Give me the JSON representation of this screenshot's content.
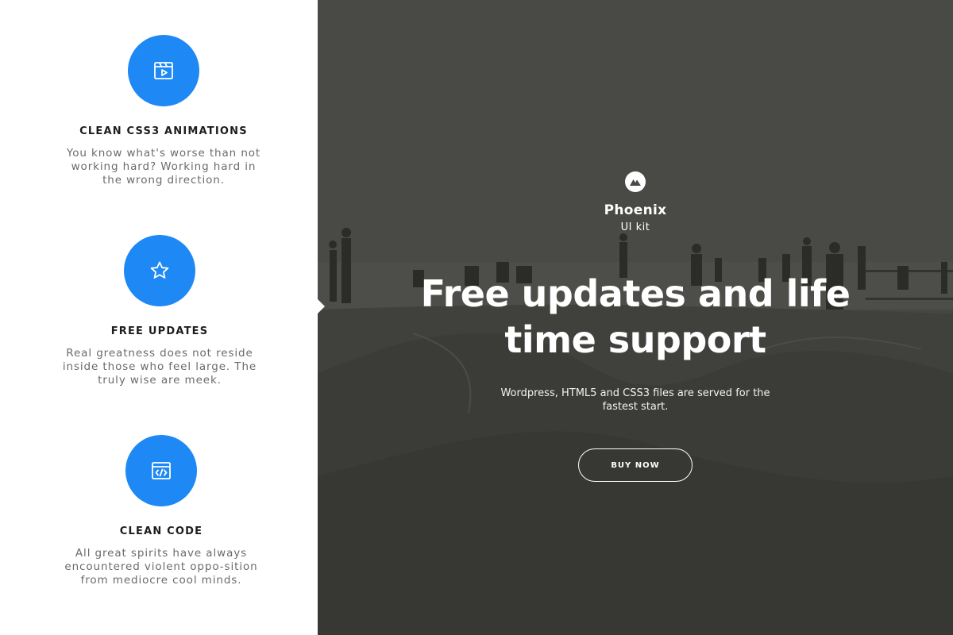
{
  "features": [
    {
      "icon": "video-icon",
      "title": "CLEAN CSS3 ANIMATIONS",
      "description": "You know what's worse than not working hard? Working hard in the wrong direction."
    },
    {
      "icon": "star-icon",
      "title": "FREE UPDATES",
      "description": "Real greatness does not reside inside those who feel large. The truly wise are meek."
    },
    {
      "icon": "code-window-icon",
      "title": "CLEAN CODE",
      "description": "All great spirits have always encountered violent oppo-sition from mediocre cool minds."
    }
  ],
  "hero": {
    "logo_icon": "mountain-logo-icon",
    "brand_name": "Phoenix",
    "brand_sub": "UI kit",
    "headline": "Free updates and life time support",
    "subtext": "Wordpress, HTML5 and CSS3 files are served for the fastest start.",
    "button_label": "BUY NOW"
  },
  "colors": {
    "accent": "#1e88f5",
    "hero_bg": "#4f4f4d",
    "text_dark": "#1d1d1f",
    "text_muted": "#6b6b6b"
  }
}
